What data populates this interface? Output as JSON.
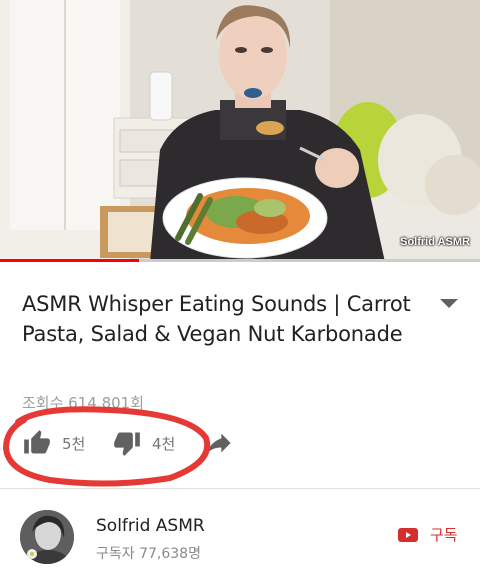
{
  "video": {
    "watermark": "Solfrid ASMR",
    "progress": 0.29
  },
  "title": "ASMR Whisper Eating Sounds | Carrot Pasta, Salad & Vegan Nut Karbonade",
  "views": "조회수 614,801회",
  "actions": {
    "like_count": "5천",
    "dislike_count": "4천"
  },
  "channel": {
    "name": "Solfrid ASMR",
    "subscribers": "구독자 77,638명"
  },
  "subscribe_label": "구독",
  "icons": [
    "expand-chevron-icon",
    "thumbs-up-icon",
    "thumbs-down-icon",
    "share-icon",
    "youtube-play-icon"
  ],
  "colors": {
    "progress": "#ff0000",
    "subscribe": "#d32f2f",
    "annotation_circle": "#e53935"
  }
}
